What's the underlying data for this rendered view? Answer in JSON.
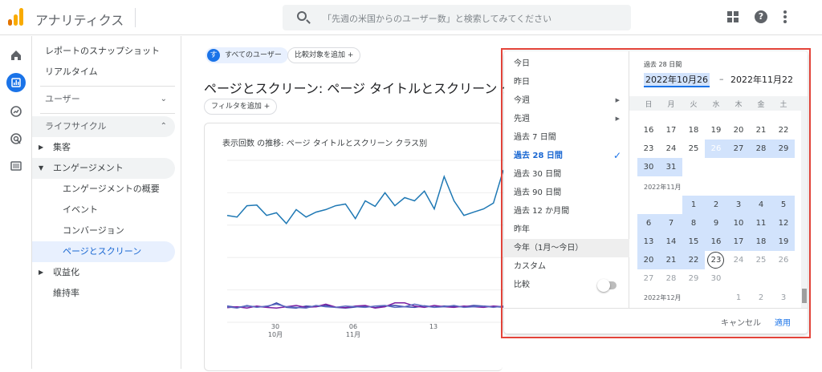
{
  "app": {
    "title": "アナリティクス",
    "brand_color": "#f9ab00",
    "accent_color": "#1a73e8"
  },
  "header": {
    "search_placeholder": "「先週の米国からのユーザー数」と検索してみてください",
    "icons": [
      "search-icon",
      "apps-grid-icon",
      "help-icon",
      "more-vert-icon"
    ]
  },
  "rail": {
    "icons": [
      "home-icon",
      "reports-icon",
      "explore-icon",
      "advertising-icon",
      "list-icon"
    ],
    "active": "reports-icon"
  },
  "sidebar": {
    "snapshot": "レポートのスナップショット",
    "realtime": "リアルタイム",
    "section_user": "ユーザー",
    "section_lifecycle": "ライフサイクル",
    "acquisition": "集客",
    "engagement": "エンゲージメント",
    "engagement_overview": "エンゲージメントの概要",
    "events": "イベント",
    "conversions": "コンバージョン",
    "pages_screens": "ページとスクリーン",
    "monetization": "収益化",
    "retention": "維持率"
  },
  "main": {
    "all_users_avatar": "す",
    "all_users": "すべてのユーザー",
    "add_comparison": "比較対象を追加",
    "page_title": "ページとスクリーン: ページ タイトルとスクリーン ク",
    "add_filter": "フィルタを追加",
    "card_title": "表示回数 の推移: ページ タイトルとスクリーン クラス別"
  },
  "chart_data": {
    "type": "line",
    "x_ticks": [
      {
        "day": "30",
        "month": "10月"
      },
      {
        "day": "06",
        "month": "11月"
      },
      {
        "day": "13",
        "month": ""
      }
    ],
    "series": [
      {
        "color": "#1e78b4",
        "values": [
          330,
          325,
          360,
          362,
          330,
          338,
          305,
          348,
          325,
          340,
          348,
          360,
          365,
          320,
          375,
          358,
          400,
          360,
          385,
          375,
          405,
          350,
          450,
          375,
          330,
          340,
          350,
          368,
          470
        ]
      },
      {
        "color": "#3949ab",
        "values": [
          50,
          46,
          50,
          48,
          47,
          60,
          46,
          44,
          50,
          48,
          52,
          46,
          44,
          47,
          50,
          45,
          50,
          52,
          48,
          46,
          51,
          47,
          50,
          49,
          48,
          52,
          50,
          48,
          47
        ]
      },
      {
        "color": "#7b1fa2",
        "values": [
          45,
          48,
          44,
          50,
          46,
          44,
          48,
          52,
          46,
          48,
          56,
          47,
          45,
          50,
          52,
          44,
          48,
          60,
          60,
          50,
          46,
          52,
          48,
          46,
          50,
          48,
          46,
          50,
          48
        ]
      },
      {
        "color": "#5c6bc0",
        "values": [
          48,
          44,
          52,
          46,
          50,
          56,
          48,
          46,
          44,
          52,
          48,
          46,
          50,
          48,
          46,
          50,
          52,
          46,
          48,
          56,
          50,
          46,
          48,
          52,
          46,
          48,
          50,
          46,
          50
        ]
      }
    ],
    "ylim": [
      0,
      500
    ],
    "grid": true
  },
  "picker": {
    "presets": [
      {
        "label": "今日"
      },
      {
        "label": "昨日"
      },
      {
        "label": "今週",
        "submenu": true
      },
      {
        "label": "先週",
        "submenu": true
      },
      {
        "label": "過去 7 日間"
      },
      {
        "label": "過去 28 日間",
        "active": true
      },
      {
        "label": "過去 30 日間"
      },
      {
        "label": "過去 90 日間"
      },
      {
        "label": "過去 12 か月間"
      },
      {
        "label": "昨年"
      },
      {
        "label": "今年（1月〜今日）",
        "hover": true
      },
      {
        "label": "カスタム"
      },
      {
        "label": "比較",
        "toggle": true
      }
    ],
    "compare_enabled": false,
    "range_label": "過去 28 日間",
    "range_start": "2022年10月26",
    "range_dash": "–",
    "range_end": "2022年11月22",
    "weekdays": [
      "日",
      "月",
      "火",
      "水",
      "木",
      "金",
      "土"
    ],
    "month_nov": "2022年11月",
    "month_dec": "2022年12月",
    "weeks": [
      [
        {
          "d": "16"
        },
        {
          "d": "17"
        },
        {
          "d": "18"
        },
        {
          "d": "19"
        },
        {
          "d": "20"
        },
        {
          "d": "21"
        },
        {
          "d": "22"
        }
      ],
      [
        {
          "d": "23"
        },
        {
          "d": "24"
        },
        {
          "d": "25"
        },
        {
          "d": "26",
          "s": "sel"
        },
        {
          "d": "27",
          "s": "inr"
        },
        {
          "d": "28",
          "s": "inr"
        },
        {
          "d": "29",
          "s": "inr"
        }
      ],
      [
        {
          "d": "30",
          "s": "inr"
        },
        {
          "d": "31",
          "s": "inr"
        },
        {
          "d": ""
        },
        {
          "d": ""
        },
        {
          "d": ""
        },
        {
          "d": ""
        },
        {
          "d": ""
        }
      ],
      [
        {
          "label": "month_nov"
        }
      ],
      [
        {
          "d": ""
        },
        {
          "d": ""
        },
        {
          "d": "1",
          "s": "inr"
        },
        {
          "d": "2",
          "s": "inr"
        },
        {
          "d": "3",
          "s": "inr"
        },
        {
          "d": "4",
          "s": "inr"
        },
        {
          "d": "5",
          "s": "inr"
        }
      ],
      [
        {
          "d": "6",
          "s": "inr"
        },
        {
          "d": "7",
          "s": "inr"
        },
        {
          "d": "8",
          "s": "inr"
        },
        {
          "d": "9",
          "s": "inr"
        },
        {
          "d": "10",
          "s": "inr"
        },
        {
          "d": "11",
          "s": "inr"
        },
        {
          "d": "12",
          "s": "inr"
        }
      ],
      [
        {
          "d": "13",
          "s": "inr"
        },
        {
          "d": "14",
          "s": "inr"
        },
        {
          "d": "15",
          "s": "inr"
        },
        {
          "d": "16",
          "s": "inr"
        },
        {
          "d": "17",
          "s": "inr"
        },
        {
          "d": "18",
          "s": "inr"
        },
        {
          "d": "19",
          "s": "inr"
        }
      ],
      [
        {
          "d": "20",
          "s": "inr"
        },
        {
          "d": "21",
          "s": "inr"
        },
        {
          "d": "22",
          "s": "inr"
        },
        {
          "d": "23",
          "s": "today"
        },
        {
          "d": "24",
          "s": "dim"
        },
        {
          "d": "25",
          "s": "dim"
        },
        {
          "d": "26",
          "s": "dim"
        }
      ],
      [
        {
          "d": "27",
          "s": "dim"
        },
        {
          "d": "28",
          "s": "dim"
        },
        {
          "d": "29",
          "s": "dim"
        },
        {
          "d": "30",
          "s": "dim"
        },
        {
          "d": ""
        },
        {
          "d": ""
        },
        {
          "d": ""
        }
      ],
      [
        {
          "label": "month_dec"
        },
        {
          "d": ""
        },
        {
          "d": ""
        },
        {
          "d": ""
        },
        {
          "d": ""
        },
        {
          "d": "1",
          "s": "dim"
        },
        {
          "d": "2",
          "s": "dim"
        },
        {
          "d": "3",
          "s": "dim"
        }
      ]
    ],
    "cancel": "キャンセル",
    "apply": "適用"
  }
}
